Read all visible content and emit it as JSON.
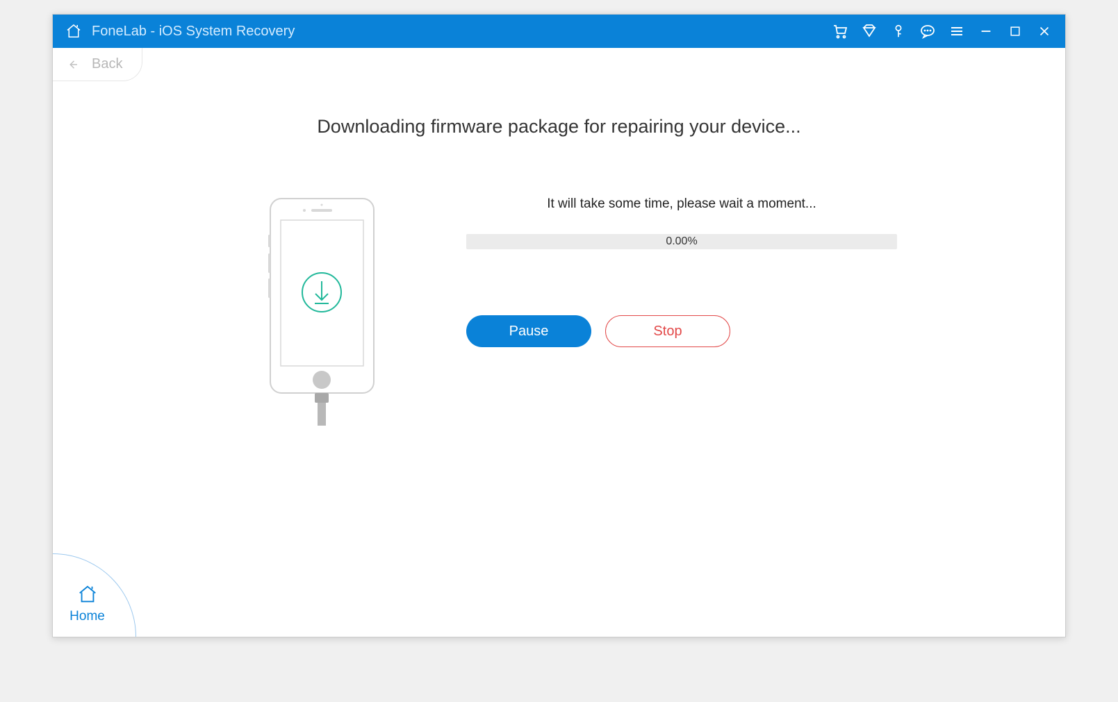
{
  "titlebar": {
    "title": "FoneLab - iOS System Recovery"
  },
  "nav": {
    "back_label": "Back"
  },
  "main": {
    "heading": "Downloading firmware package for repairing your device...",
    "status_text": "It will take some time, please wait a moment...",
    "progress_percent": "0.00%",
    "pause_label": "Pause",
    "stop_label": "Stop"
  },
  "footer": {
    "home_label": "Home"
  },
  "colors": {
    "accent": "#0a82d8",
    "stop_red": "#e24848",
    "download_teal": "#21b89a"
  }
}
